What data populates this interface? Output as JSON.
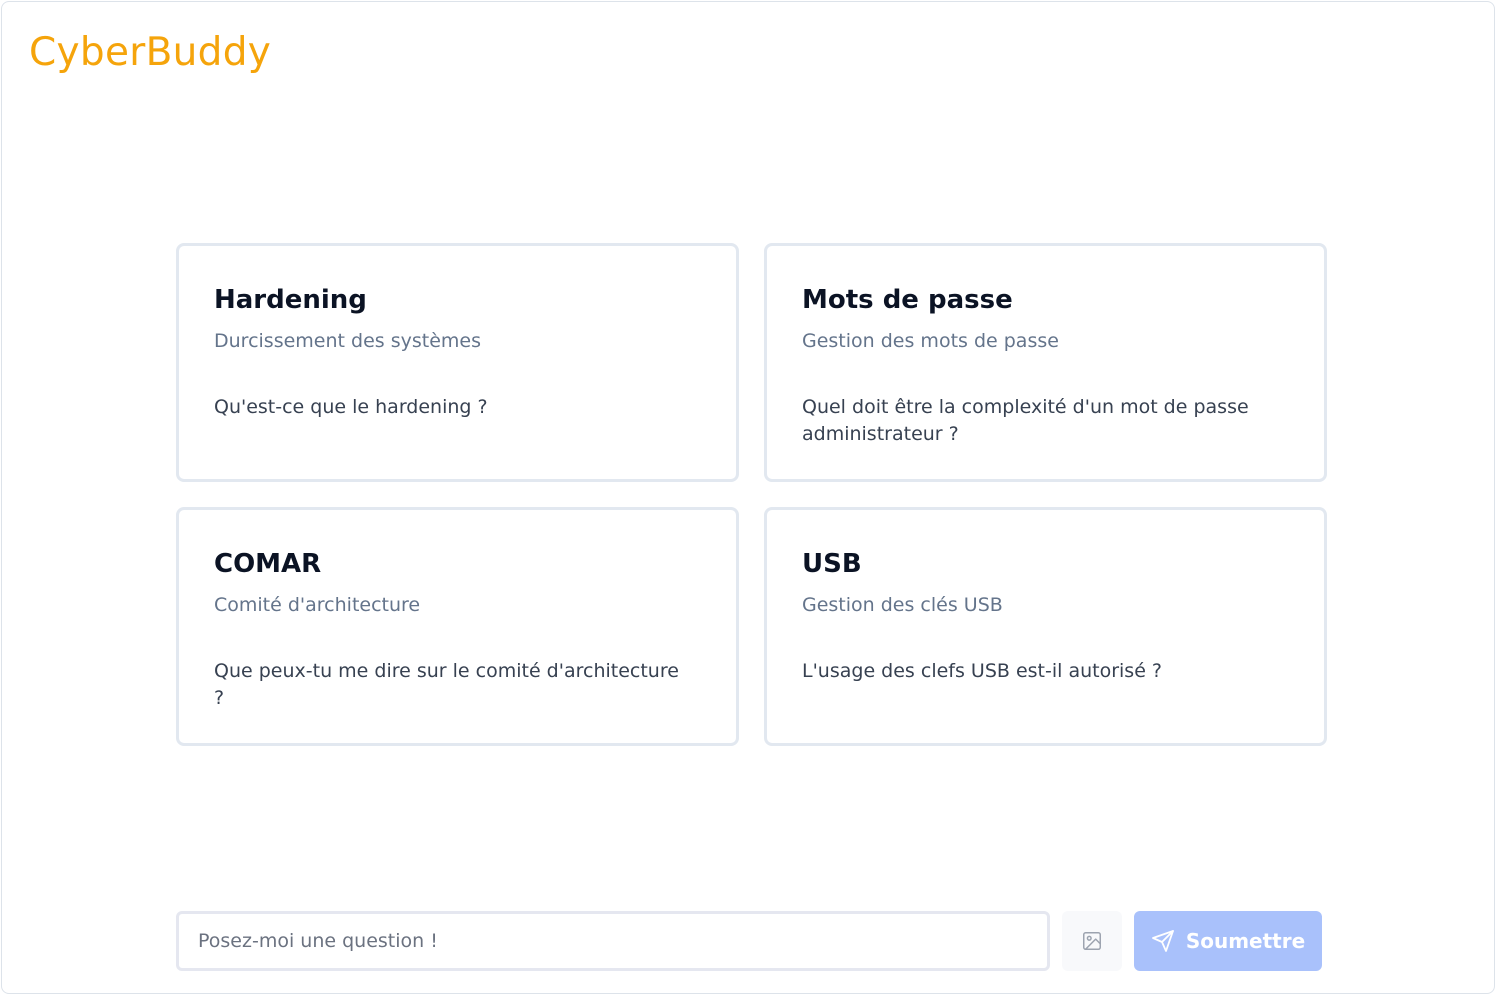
{
  "app": {
    "brand": "CyberBuddy",
    "brand_color": "#f5a40b"
  },
  "cards": [
    {
      "title": "Hardening",
      "subtitle": "Durcissement des systèmes",
      "question": "Qu'est-ce que le hardening ?"
    },
    {
      "title": "Mots de passe",
      "subtitle": "Gestion des mots de passe",
      "question": "Quel doit être la complexité d'un mot de passe administrateur ?"
    },
    {
      "title": "COMAR",
      "subtitle": "Comité d'architecture",
      "question": "Que peux-tu me dire sur le comité d'architecture ?"
    },
    {
      "title": "USB",
      "subtitle": "Gestion des clés USB",
      "question": "L'usage des clefs USB est-il autorisé ?"
    }
  ],
  "composer": {
    "placeholder": "Posez-moi une question !",
    "value": "",
    "image_icon": "image-icon",
    "submit_icon": "send-icon",
    "submit_label": "Soumettre",
    "submit_color": "#a9c1fb"
  }
}
